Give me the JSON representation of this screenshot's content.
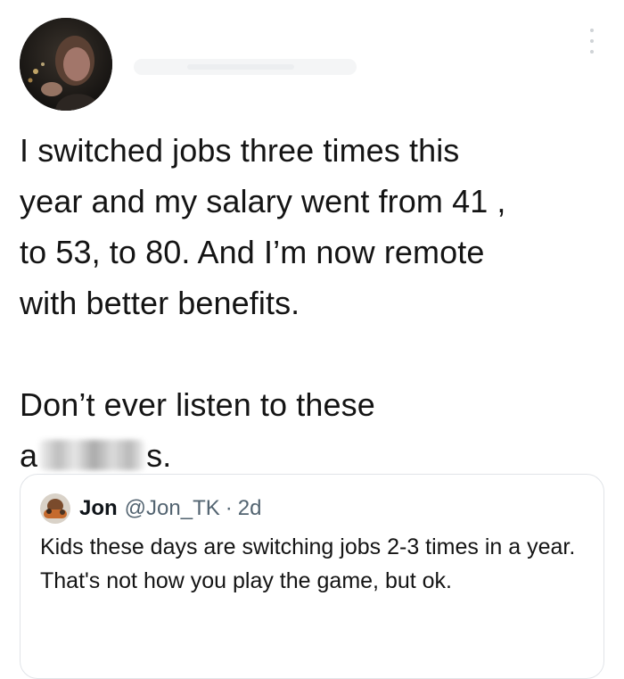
{
  "tweet": {
    "text_lines": [
      "I switched jobs three times this",
      "year and my salary went from 41 ,",
      "to 53, to 80. And I’m now remote",
      "with better benefits."
    ],
    "second_para_line1": "Don’t ever listen to these",
    "second_para_start": "a",
    "second_para_end": "s."
  },
  "quoted": {
    "name": "Jon",
    "handle": "@Jon_TK",
    "separator": "·",
    "time": "2d",
    "text": "Kids these days are switching jobs 2-3 times in a year. That's not how you play the game, but ok."
  },
  "icons": {
    "more": "more-vertical-icon"
  }
}
